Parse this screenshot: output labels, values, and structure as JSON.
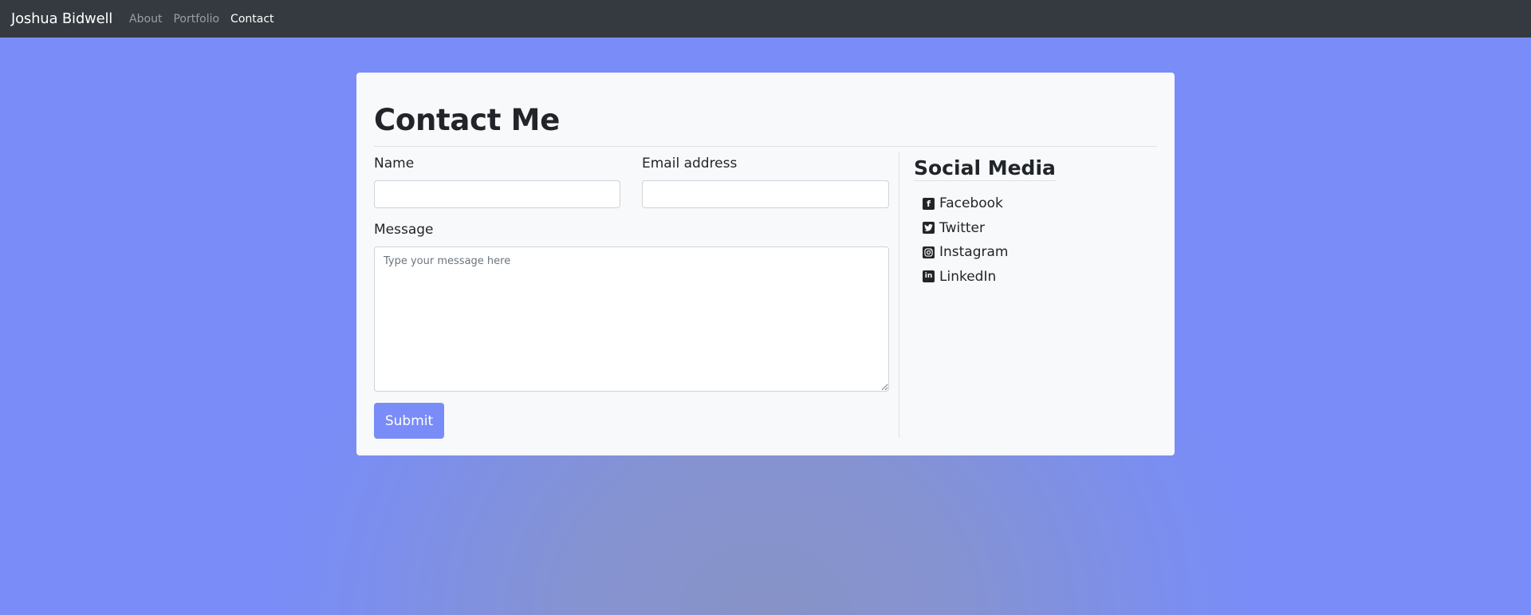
{
  "navbar": {
    "brand": "Joshua Bidwell",
    "links": [
      {
        "label": "About",
        "active": false
      },
      {
        "label": "Portfolio",
        "active": false
      },
      {
        "label": "Contact",
        "active": true
      }
    ]
  },
  "form": {
    "title": "Contact Me",
    "name_label": "Name",
    "name_value": "",
    "email_label": "Email address",
    "email_value": "",
    "message_label": "Message",
    "message_placeholder": "Type your message here",
    "submit_label": "Submit"
  },
  "social": {
    "title": "Social Media",
    "items": [
      {
        "label": "Facebook",
        "icon": "facebook-icon"
      },
      {
        "label": "Twitter",
        "icon": "twitter-icon"
      },
      {
        "label": "Instagram",
        "icon": "instagram-icon"
      },
      {
        "label": "LinkedIn",
        "icon": "linkedin-icon"
      }
    ]
  },
  "colors": {
    "navbar_bg": "#343a40",
    "accent": "#7a8cf7",
    "card_bg": "#f8f9fa"
  }
}
